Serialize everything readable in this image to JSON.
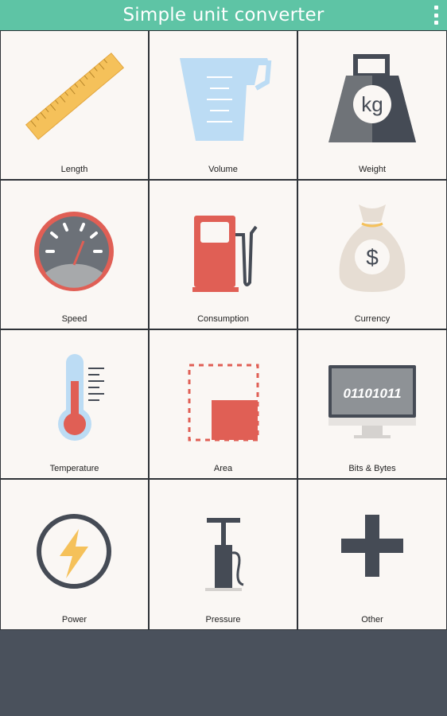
{
  "app": {
    "title": "Simple unit converter"
  },
  "tiles": [
    {
      "label": "Length"
    },
    {
      "label": "Volume"
    },
    {
      "label": "Weight"
    },
    {
      "label": "Speed"
    },
    {
      "label": "Consumption"
    },
    {
      "label": "Currency"
    },
    {
      "label": "Temperature"
    },
    {
      "label": "Area"
    },
    {
      "label": "Bits & Bytes"
    },
    {
      "label": "Power"
    },
    {
      "label": "Pressure"
    },
    {
      "label": "Other"
    }
  ],
  "icons": {
    "weight_text": "kg",
    "currency_text": "$",
    "bits_text": "01101011"
  },
  "colors": {
    "appbar": "#5ec4a5",
    "tile_bg": "#faf7f4",
    "accent_red": "#e05f55",
    "dark": "#454b55",
    "bottom_bar": "#4a515c"
  }
}
